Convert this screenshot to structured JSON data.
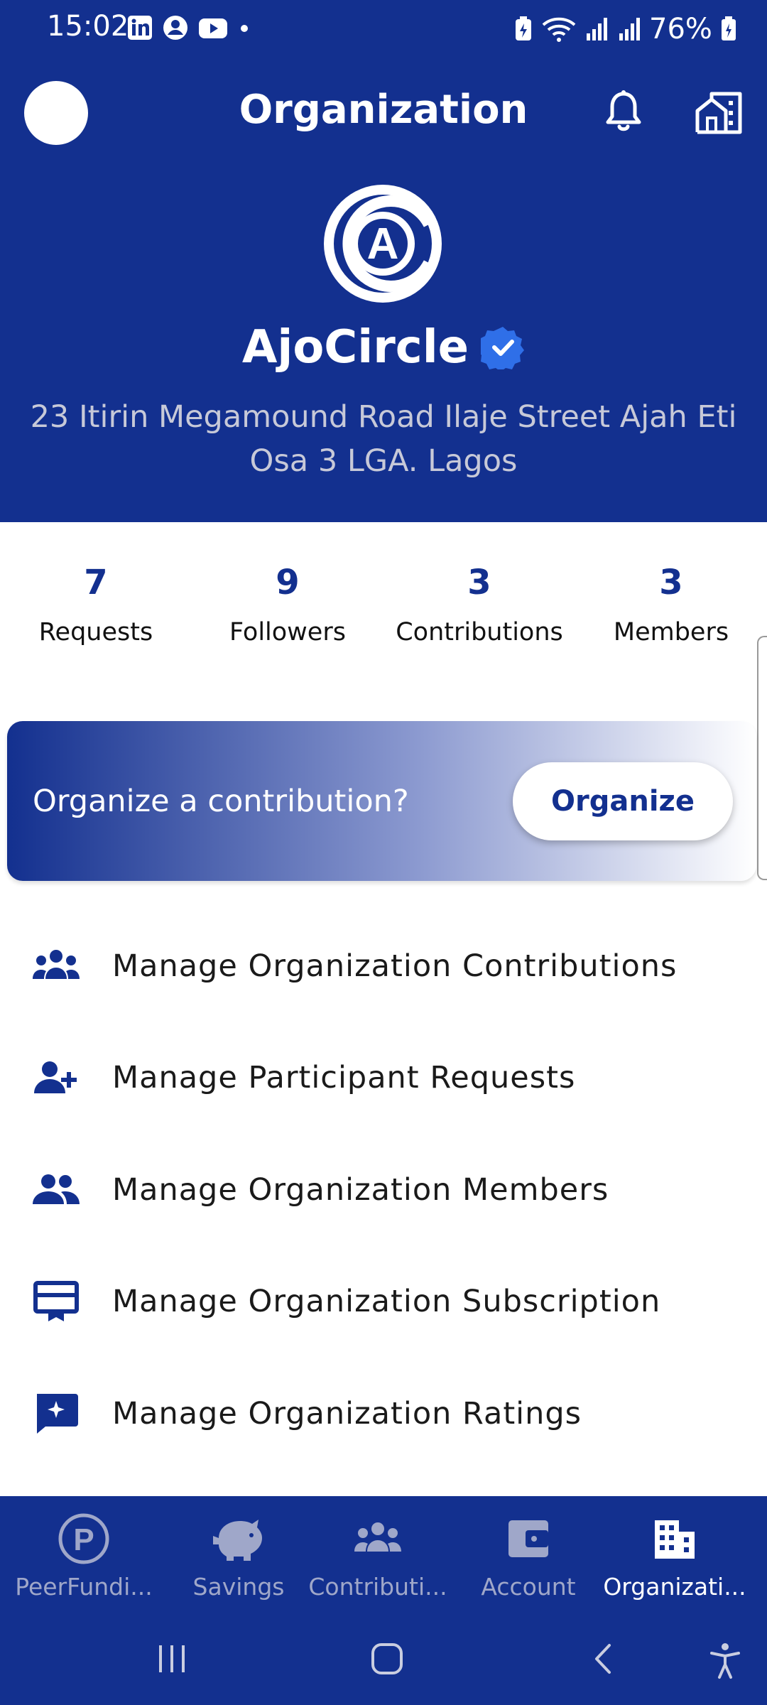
{
  "status_bar": {
    "time": "15:02",
    "battery": "76%"
  },
  "header": {
    "title": "Organization"
  },
  "org": {
    "logo_letter": "A",
    "name": "AjoCircle",
    "address": "23 Itirin Megamound Road Ilaje Street Ajah Eti Osa 3 LGA. Lagos"
  },
  "stats": [
    {
      "value": "7",
      "label": "Requests"
    },
    {
      "value": "9",
      "label": "Followers"
    },
    {
      "value": "3",
      "label": "Contributions"
    },
    {
      "value": "3",
      "label": "Members"
    }
  ],
  "promo": {
    "text": "Organize a contribution?",
    "button_label": "Organize"
  },
  "menu": [
    {
      "label": "Manage Organization Contributions",
      "icon": "groups-icon"
    },
    {
      "label": "Manage Participant Requests",
      "icon": "person-add-icon"
    },
    {
      "label": "Manage Organization Members",
      "icon": "people-icon"
    },
    {
      "label": "Manage Organization Subscription",
      "icon": "subscription-card-icon"
    },
    {
      "label": "Manage Organization Ratings",
      "icon": "rating-chat-icon"
    }
  ],
  "bottom_nav": [
    {
      "label": "PeerFundi...",
      "icon": "peerfunding-icon"
    },
    {
      "label": "Savings",
      "icon": "piggy-bank-icon"
    },
    {
      "label": "Contributi...",
      "icon": "contributions-icon"
    },
    {
      "label": "Account",
      "icon": "wallet-icon"
    },
    {
      "label": "Organizati...",
      "icon": "building-icon",
      "active": true
    }
  ],
  "colors": {
    "primary": "#13308f",
    "verified": "#2f6fe8",
    "white": "#ffffff"
  }
}
